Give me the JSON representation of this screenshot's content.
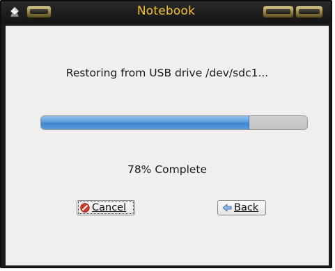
{
  "window": {
    "title": "Notebook"
  },
  "dialog": {
    "status_text": "Restoring from USB drive /dev/sdc1...",
    "progress_fraction": 0.78,
    "progress_text": "78% Complete"
  },
  "buttons": {
    "cancel_label": "Cancel",
    "back_label": "Back"
  },
  "icons": {
    "menu": "window-menu-icon",
    "cancel": "stop-icon",
    "back": "back-arrow-icon"
  },
  "colors": {
    "title_text": "#f2c23a",
    "progress_fill": "#4a90d9",
    "cancel_icon": "#d23a2a"
  }
}
